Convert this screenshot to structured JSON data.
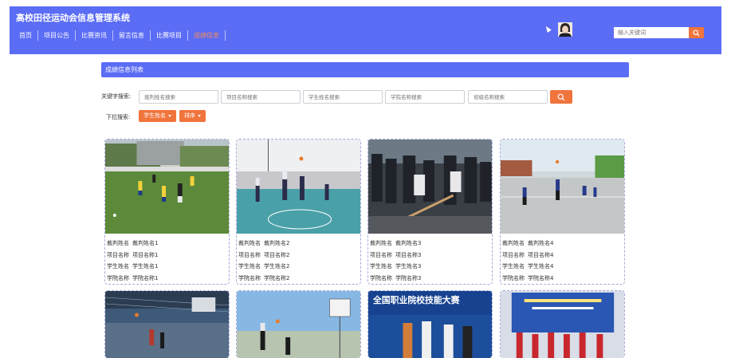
{
  "header": {
    "title": "高校田径运动会信息管理系统",
    "nav": [
      {
        "label": "首页",
        "active": false
      },
      {
        "label": "项目公告",
        "active": false
      },
      {
        "label": "比赛资讯",
        "active": false
      },
      {
        "label": "留言信息",
        "active": false
      },
      {
        "label": "比赛项目",
        "active": false
      },
      {
        "label": "成绩信息",
        "active": true
      }
    ],
    "search_placeholder": "输入关键词",
    "accent_color": "#5b6cf5",
    "button_color": "#f0743c"
  },
  "panel": {
    "title": "成绩信息列表",
    "keyword_label": "关键字搜索:",
    "filters": [
      {
        "placeholder": "裁判姓名搜索"
      },
      {
        "placeholder": "项目名称搜索"
      },
      {
        "placeholder": "学生姓名搜索"
      },
      {
        "placeholder": "学院名称搜索"
      },
      {
        "placeholder": "班级名称搜索"
      }
    ],
    "dropdown_label": "下拉搜索:",
    "dropdowns": [
      {
        "label": "学生姓名"
      },
      {
        "label": "排序"
      }
    ]
  },
  "field_labels": {
    "referee": "裁判姓名",
    "project": "项目名称",
    "student": "学生姓名",
    "college": "学院名称"
  },
  "cards": [
    {
      "referee": "裁判姓名1",
      "project": "项目名称1",
      "student": "学生姓名1",
      "college": "学院名称1",
      "image": "soccer-match-photo"
    },
    {
      "referee": "裁判姓名2",
      "project": "项目名称2",
      "student": "学生姓名2",
      "college": "学院名称2",
      "image": "basketball-game-photo"
    },
    {
      "referee": "裁判姓名3",
      "project": "项目名称3",
      "student": "学生姓名3",
      "college": "学院名称3",
      "image": "tug-of-war-photo"
    },
    {
      "referee": "裁判姓名4",
      "project": "项目名称4",
      "student": "学生姓名4",
      "college": "学院名称4",
      "image": "outdoor-basketball-photo"
    }
  ],
  "second_row_images": [
    {
      "image": "indoor-court-photo",
      "caption": ""
    },
    {
      "image": "basketball-dunk-photo",
      "caption": ""
    },
    {
      "image": "skills-competition-photo",
      "caption": "全国职业院校技能大赛"
    },
    {
      "image": "award-ceremony-photo",
      "caption": ""
    }
  ]
}
